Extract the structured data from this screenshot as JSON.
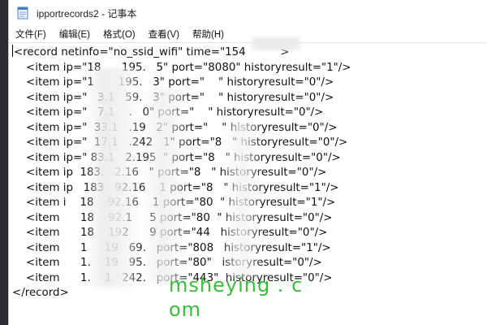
{
  "window": {
    "title": "ipportrecords2 - 记事本"
  },
  "menu": [
    {
      "label": "文件(F)"
    },
    {
      "label": "编辑(E)"
    },
    {
      "label": "格式(O)"
    },
    {
      "label": "查看(V)"
    },
    {
      "label": "帮助(H)"
    }
  ],
  "editor": {
    "lines": [
      "<record netinfo=\"no_ssid_wifi\" time=\"154          >",
      "    <item ip=\"18      195.   5\" port=\"8080\" historyresult=\"1\"/>",
      "    <item ip=\"1       195.   3\" port=\"    \" historyresult=\"0\"/>",
      "    <item ip=\"   3.1   59.   3\" port=\"    \" historyresult=\"0\"/>",
      "    <item ip=\"   7.1    .   0\" port=\"    \" historyresult=\"0\"/>",
      "    <item ip=\"  33.1   .19   2\" port=\"    \" historyresult=\"0\"/>",
      "    <item ip=\"  17.1   .242   1\" port=\"8   \" historyresult=\"0\"/>",
      "    <item ip=\" 83.1   2.195  \" port=\"8   \" historyresult=\"0\"/>",
      "    <item ip  183.   2.16   \" port=\"8   \" historyresult=\"0\"/>",
      "    <item ip   183   92.16    1 port=\"8   \" historyresult=\"1\"/>",
      "    <item i    18    92.16    1 port=\"80  \" historyresult=\"1\"/>",
      "    <item      18    92.1     5 port=\"80  \" historyresult=\"0\"/>",
      "    <item      18    192      9 port=\"44   historyresult=\"0\"/>",
      "    <item      1     19   69.   port=\"808   historyresult=\"1\"/>",
      "    <item      1.    19   95.   port=\"80\"   istoryresult=\"0\"/>",
      "    <item      1.    1   242.   port=\"443\"  historyresult=\"0\"/>",
      "</record>"
    ]
  },
  "watermark": {
    "line1": "msheying . c",
    "line2": "om"
  }
}
